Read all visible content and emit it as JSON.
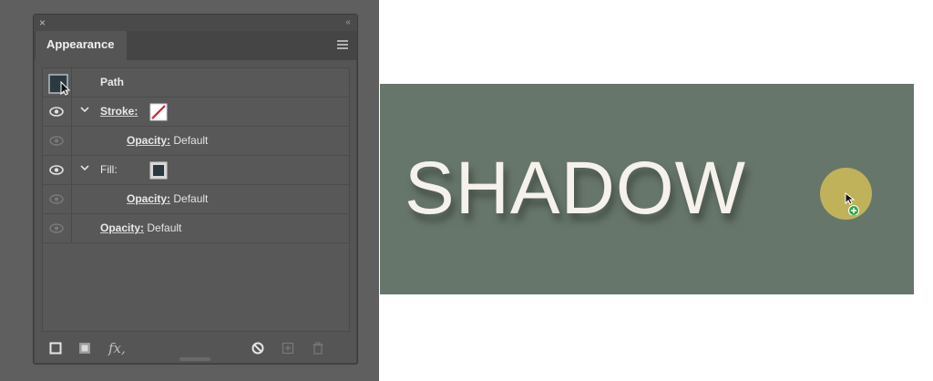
{
  "panel": {
    "close_glyph": "×",
    "collapse_glyph": "‹‹",
    "tab_title": "Appearance",
    "menu_icon": "hamburger-menu-icon",
    "rows": {
      "path": {
        "label": "Path"
      },
      "stroke": {
        "label": "Stroke:",
        "swatch": "none-swatch-red-slash"
      },
      "stroke_opacity": {
        "label": "Opacity:",
        "value": "Default"
      },
      "fill": {
        "label": "Fill:",
        "swatch": "dark-fill-swatch"
      },
      "fill_opacity": {
        "label": "Opacity:",
        "value": "Default"
      },
      "opacity": {
        "label": "Opacity:",
        "value": "Default"
      }
    },
    "bottom_icons": [
      "add-new-stroke-icon",
      "add-new-fill-icon",
      "fx-icon",
      "clear-appearance-icon",
      "duplicate-item-icon",
      "delete-item-icon"
    ],
    "fx_label": "fx,"
  },
  "canvas": {
    "background": "#67766a",
    "text": "SHADOW",
    "text_color": "#f5f1eb",
    "eyedropper_circle_color": "#bfb25a"
  },
  "colors": {
    "panel_bg": "#555555",
    "window_bg": "#5f5f5f",
    "stroke_none_red": "#d0212d"
  }
}
